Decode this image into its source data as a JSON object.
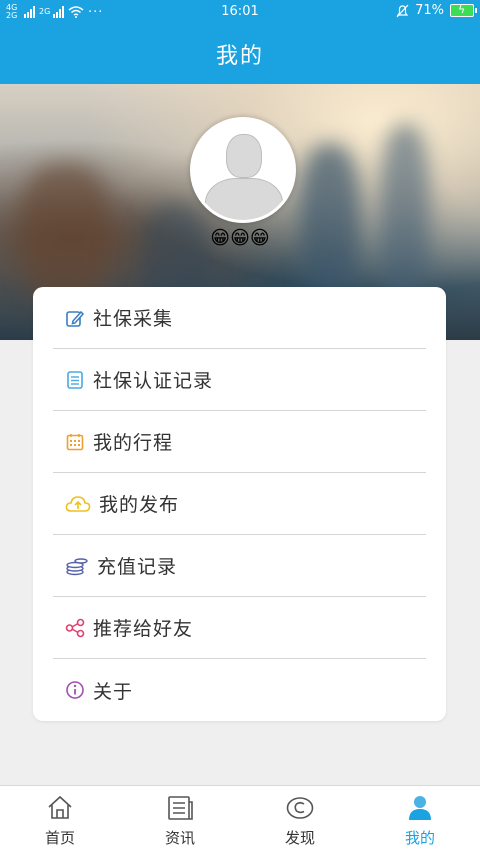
{
  "status_bar": {
    "network_1": "4G",
    "network_1b": "2G",
    "network_2": "2G",
    "time": "16:01",
    "battery_percent": "71%",
    "battery_level": 0.71
  },
  "header": {
    "title": "我的"
  },
  "profile": {
    "nickname": "😁😁😁"
  },
  "menu": {
    "items": [
      {
        "label": "社保采集",
        "icon": "edit-icon",
        "color": "#3a7cc4"
      },
      {
        "label": "社保认证记录",
        "icon": "list-icon",
        "color": "#4aa8e0"
      },
      {
        "label": "我的行程",
        "icon": "calendar-icon",
        "color": "#f0a030"
      },
      {
        "label": "我的发布",
        "icon": "cloud-upload-icon",
        "color": "#f0c020"
      },
      {
        "label": "充值记录",
        "icon": "coins-icon",
        "color": "#5560a8"
      },
      {
        "label": "推荐给好友",
        "icon": "share-icon",
        "color": "#e04070"
      },
      {
        "label": "关于",
        "icon": "info-icon",
        "color": "#a050b0"
      }
    ]
  },
  "bottom_nav": {
    "tabs": [
      {
        "label": "首页",
        "icon": "home-icon",
        "active": false
      },
      {
        "label": "资讯",
        "icon": "news-icon",
        "active": false
      },
      {
        "label": "发现",
        "icon": "discover-icon",
        "active": false
      },
      {
        "label": "我的",
        "icon": "user-icon",
        "active": true
      }
    ]
  },
  "colors": {
    "accent": "#1aa3e0",
    "background": "#efefef"
  }
}
